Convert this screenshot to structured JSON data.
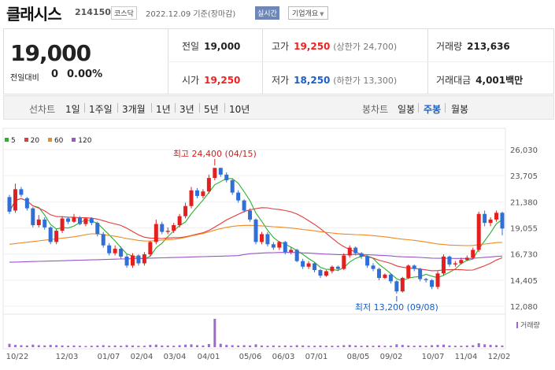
{
  "header": {
    "name": "클래시스",
    "code": "214150",
    "market": "코스닥",
    "date": "2022.12.09 기준(장마감)",
    "realtime": "실시간",
    "company_info": "기업개요"
  },
  "quote": {
    "price": "19,000",
    "change_label": "전일대비",
    "change_value": "0",
    "change_pct": "0.00%",
    "prev_label": "전일",
    "prev": "19,000",
    "high_label": "고가",
    "high": "19,250",
    "upper": "(상한가 24,700)",
    "volume_label": "거래량",
    "volume": "213,636",
    "open_label": "시가",
    "open": "19,250",
    "low_label": "저가",
    "low": "18,250",
    "lower": "(하한가 13,300)",
    "amount_label": "거래대금",
    "amount": "4,001",
    "amount_unit": "백만"
  },
  "tabs": {
    "line_chart": "선차트",
    "periods": [
      "1일",
      "1주일",
      "3개월",
      "1년",
      "3년",
      "5년",
      "10년"
    ],
    "candle_chart": "봉차트",
    "daily": "일봉",
    "weekly": "주봉",
    "monthly": "월봉"
  },
  "legend": [
    {
      "label": "5",
      "color": "#2fae2f"
    },
    {
      "label": "20",
      "color": "#e23b3b"
    },
    {
      "label": "60",
      "color": "#f08a1e"
    },
    {
      "label": "120",
      "color": "#9b55c8"
    }
  ],
  "volume_label": "거래량",
  "colors": {
    "up": "#e22020",
    "down": "#2f6fd6",
    "accent": "#1a5fc8"
  },
  "chart_data": {
    "type": "candlestick",
    "yticks": [
      "26,030",
      "23,705",
      "21,380",
      "19,055",
      "16,730",
      "14,405",
      "12,080"
    ],
    "ylim": [
      12080,
      26030
    ],
    "xticks": [
      "10/22",
      "12/03",
      "01/07",
      "02/04",
      "03/04",
      "04/01",
      "05/06",
      "06/03",
      "07/01",
      "08/05",
      "09/02",
      "10/07",
      "11/04",
      "12/02"
    ],
    "max_annotation": "최고 24,400 (04/15)",
    "min_annotation": "최저 13,200 (09/08)",
    "closes": [
      20500,
      22500,
      22000,
      20800,
      19300,
      19800,
      19100,
      17800,
      18800,
      19900,
      19600,
      20000,
      19400,
      19900,
      19500,
      18500,
      17500,
      16800,
      17200,
      16500,
      15700,
      16600,
      15900,
      16700,
      17800,
      19400,
      18700,
      18800,
      19300,
      20100,
      21000,
      22400,
      21900,
      22300,
      23500,
      24400,
      23800,
      23300,
      22200,
      21500,
      20600,
      19800,
      17800,
      18500,
      17600,
      17300,
      17800,
      16900,
      17100,
      16100,
      15600,
      15900,
      15300,
      14800,
      15200,
      15600,
      15400,
      16600,
      17300,
      16800,
      16500,
      15700,
      15400,
      14600,
      14900,
      14300,
      13400,
      14600,
      15700,
      15400,
      14500,
      14400,
      13800,
      15000,
      16500,
      15800,
      15900,
      16200,
      16400,
      17100,
      20300,
      19500,
      19800,
      20400,
      19000
    ],
    "opens": [
      21800,
      20600,
      22500,
      21700,
      20800,
      19300,
      19800,
      19100,
      17800,
      18800,
      19900,
      19600,
      20000,
      19400,
      19900,
      19500,
      18500,
      17500,
      16800,
      17200,
      16500,
      15700,
      16600,
      15900,
      16700,
      17800,
      19400,
      18700,
      18800,
      19300,
      20100,
      21000,
      22400,
      21900,
      22300,
      23500,
      24400,
      23800,
      23300,
      22200,
      21500,
      20600,
      19800,
      17800,
      18500,
      17600,
      17300,
      17800,
      16900,
      17100,
      16100,
      15600,
      15900,
      15300,
      14800,
      15200,
      15600,
      15400,
      16600,
      17300,
      16800,
      16500,
      15700,
      15400,
      14600,
      14900,
      14300,
      13400,
      14600,
      15700,
      15400,
      14500,
      14400,
      13800,
      15000,
      16500,
      15800,
      15900,
      16200,
      16400,
      17100,
      20300,
      19500,
      19800,
      20400
    ],
    "highs": [
      22000,
      23000,
      22700,
      21800,
      20900,
      20200,
      20000,
      19200,
      19000,
      20100,
      20000,
      20300,
      20100,
      20000,
      20000,
      19600,
      18700,
      17700,
      17500,
      17400,
      16700,
      16800,
      16700,
      16900,
      17900,
      19800,
      19600,
      19100,
      19500,
      20300,
      21300,
      22700,
      22600,
      22500,
      23800,
      24400,
      24400,
      24000,
      23400,
      22400,
      21600,
      20800,
      19900,
      18700,
      18700,
      17800,
      17900,
      17900,
      17300,
      17200,
      16300,
      16100,
      16000,
      15400,
      15300,
      15700,
      15700,
      16800,
      17500,
      17400,
      16900,
      16600,
      15900,
      15500,
      15000,
      15000,
      14400,
      14700,
      15800,
      15800,
      15500,
      14600,
      14500,
      15200,
      16700,
      16600,
      16100,
      16400,
      16600,
      17300,
      20500,
      20600,
      20000,
      20600,
      20500
    ],
    "lows": [
      20300,
      20400,
      21800,
      20600,
      19100,
      19100,
      18900,
      17600,
      17600,
      18600,
      19400,
      19500,
      19300,
      19200,
      19300,
      18300,
      17300,
      16600,
      16600,
      16300,
      15500,
      15500,
      15700,
      15700,
      16500,
      17600,
      18500,
      18500,
      18600,
      19100,
      19900,
      20800,
      21700,
      21700,
      22100,
      23300,
      23600,
      23100,
      22000,
      21300,
      20400,
      19600,
      17600,
      17600,
      17400,
      17100,
      17100,
      16700,
      16700,
      16000,
      15400,
      15400,
      15100,
      14600,
      14700,
      15000,
      15200,
      15300,
      16400,
      16600,
      16300,
      15500,
      15200,
      14400,
      14500,
      14100,
      13200,
      13300,
      14500,
      15200,
      14300,
      14200,
      13600,
      13600,
      14800,
      15600,
      15600,
      15800,
      16100,
      16300,
      16900,
      19200,
      19200,
      19600,
      18400
    ],
    "volumes": [
      1.2,
      0.8,
      0.7,
      0.6,
      0.9,
      0.7,
      0.6,
      0.8,
      0.7,
      0.6,
      0.5,
      0.6,
      0.5,
      0.4,
      0.5,
      0.6,
      0.7,
      0.5,
      0.6,
      0.5,
      0.7,
      0.6,
      0.5,
      0.5,
      0.8,
      0.9,
      0.6,
      0.6,
      0.5,
      0.7,
      0.9,
      1.0,
      0.7,
      0.6,
      1.1,
      10.0,
      1.2,
      0.8,
      0.7,
      0.6,
      0.7,
      0.6,
      1.0,
      0.6,
      0.5,
      0.6,
      0.5,
      0.6,
      0.5,
      0.7,
      0.6,
      0.5,
      0.5,
      0.6,
      0.5,
      0.5,
      0.5,
      0.7,
      0.8,
      0.6,
      0.5,
      0.6,
      0.5,
      0.6,
      0.5,
      0.5,
      1.0,
      0.8,
      0.6,
      0.5,
      0.6,
      0.5,
      0.7,
      0.8,
      0.9,
      0.6,
      0.5,
      0.5,
      0.6,
      0.7,
      1.4,
      1.0,
      0.8,
      0.7,
      0.6
    ]
  }
}
